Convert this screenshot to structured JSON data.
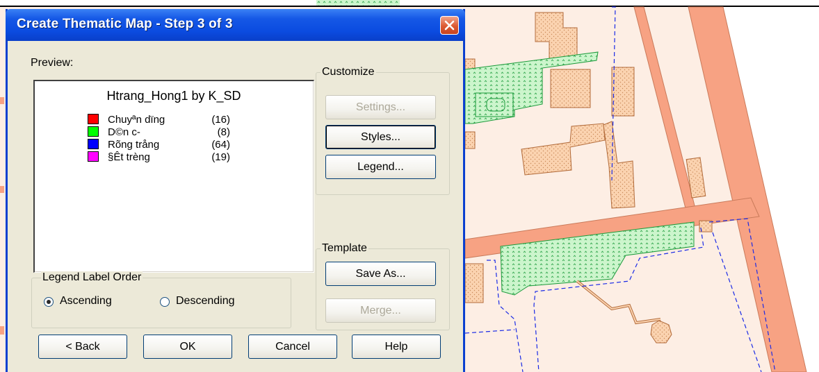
{
  "dialog": {
    "title": "Create Thematic Map - Step 3 of 3",
    "preview_label": "Preview:",
    "preview_title": "Htrang_Hong1 by K_SD",
    "legend_items": [
      {
        "label": "Chuyªn dïng",
        "count": "(16)",
        "color": "#ff0000"
      },
      {
        "label": "D©n c-",
        "count": "(8)",
        "color": "#00ff00"
      },
      {
        "label": "Rõng trång",
        "count": "(64)",
        "color": "#0000ff"
      },
      {
        "label": "§Êt trèng",
        "count": "(19)",
        "color": "#ff00ff"
      }
    ],
    "customize": {
      "title": "Customize",
      "settings_label": "Settings...",
      "styles_label": "Styles...",
      "legend_label": "Legend..."
    },
    "template": {
      "title": "Template",
      "save_as_label": "Save As...",
      "merge_label": "Merge..."
    },
    "order": {
      "title": "Legend Label Order",
      "ascending_label": "Ascending",
      "descending_label": "Descending",
      "selected": "Ascending"
    },
    "buttons": {
      "back": "< Back",
      "ok": "OK",
      "cancel": "Cancel",
      "help": "Help"
    }
  },
  "colors": {
    "titlebar": "#0b4be0",
    "dialog_bg": "#ece9d8",
    "map_bg": "#fdeee4",
    "road": "#f7a283",
    "building": "#f7c9a0",
    "park": "#c8f7c8"
  }
}
